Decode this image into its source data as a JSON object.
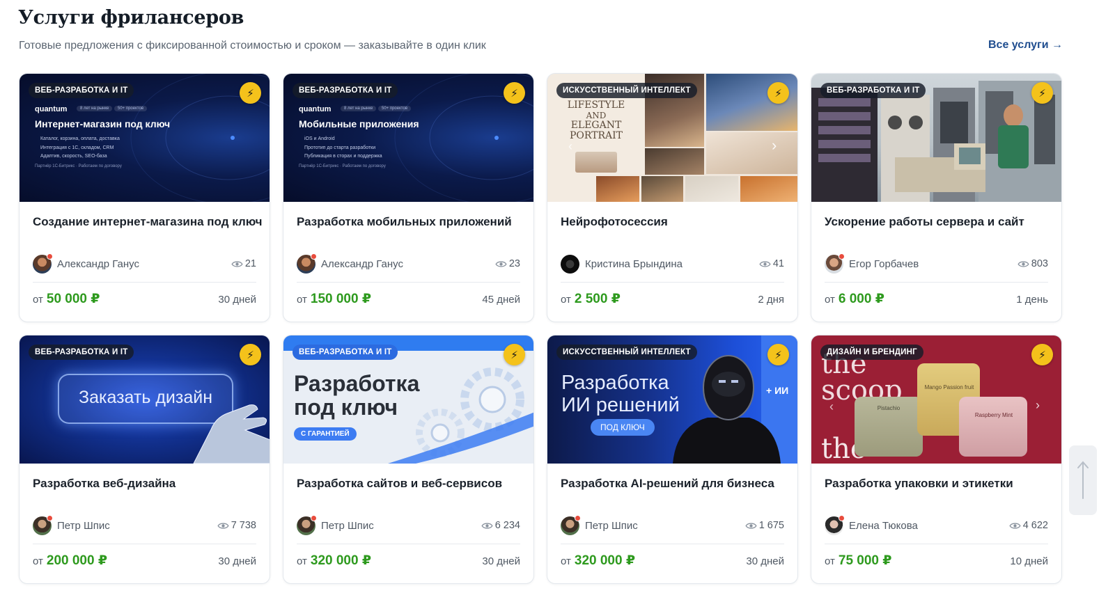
{
  "header": {
    "title": "Услуги фрилансеров",
    "subtitle": "Готовые предложения с фиксированной стоимостью и сроком — заказывайте в один клик",
    "all_link": "Все услуги →"
  },
  "colors": {
    "price_green": "#2e9a1e",
    "link_blue": "#1f4d8f",
    "bolt_yellow": "#f4c21b"
  },
  "cards": [
    {
      "category": "ВЕБ-РАЗРАБОТКА И IT",
      "image": {
        "brand": "quantum",
        "tag1": "8 лет на рынке",
        "tag2": "50+ проектов",
        "headline": "Интернет-магазин под ключ",
        "bullets": [
          "Каталог, корзина, оплата, доставка",
          "Интеграция с 1С, складом, CRM",
          "Адаптив, скорость, SEO-база"
        ],
        "footer": "Партнёр 1С-Битрикс · Работаем по договору"
      },
      "title": "Создание интернет-магазина под ключ",
      "author": "Александр Ганус",
      "views": "21",
      "price_prefix": "от",
      "price": "50 000 ₽",
      "duration": "30 дней"
    },
    {
      "category": "ВЕБ-РАЗРАБОТКА И IT",
      "image": {
        "brand": "quantum",
        "tag1": "8 лет на рынке",
        "tag2": "50+ проектов",
        "headline": "Мобильные приложения",
        "bullets": [
          "iOS и Android",
          "Прототип до старта разработки",
          "Публикация в сторах и поддержка"
        ],
        "footer": "Партнёр 1С-Битрикс · Работаем по договору"
      },
      "title": "Разработка мобильных приложений",
      "author": "Александр Ганус",
      "views": "23",
      "price_prefix": "от",
      "price": "150 000 ₽",
      "duration": "45 дней"
    },
    {
      "category": "ИСКУССТВЕННЫЙ ИНТЕЛЛЕКТ",
      "image": {
        "line1": "LIFESTYLE",
        "line2": "AND",
        "line3": "ELEGANT",
        "line4": "PORTRAIT"
      },
      "title": "Нейрофотосессия",
      "author": "Кристина Брындина",
      "views": "41",
      "price_prefix": "от",
      "price": "2 500 ₽",
      "duration": "2 дня"
    },
    {
      "category": "ВЕБ-РАЗРАБОТКА И IT",
      "image": {},
      "title": "Ускорение работы сервера и сайт",
      "author": "Егор Горбачев",
      "views": "803",
      "price_prefix": "от",
      "price": "6 000 ₽",
      "duration": "1 день"
    },
    {
      "category": "ВЕБ-РАЗРАБОТКА И IT",
      "image": {
        "button_text": "Заказать дизайн"
      },
      "title": "Разработка веб-дизайна",
      "author": "Петр Шпис",
      "views": "7 738",
      "price_prefix": "от",
      "price": "200 000 ₽",
      "duration": "30 дней"
    },
    {
      "category": "ВЕБ-РАЗРАБОТКА И IT",
      "image": {
        "line1": "Разработка",
        "line2": "под ключ",
        "pill": "С ГАРАНТИЕЙ"
      },
      "title": "Разработка сайтов и веб-сервисов",
      "author": "Петр Шпис",
      "views": "6 234",
      "price_prefix": "от",
      "price": "320 000 ₽",
      "duration": "30 дней"
    },
    {
      "category": "ИСКУССТВЕННЫЙ ИНТЕЛЛЕКТ",
      "image": {
        "line1": "Разработка",
        "line2": "ИИ решений",
        "pill": "ПОД КЛЮЧ",
        "side": "+ ИИ"
      },
      "title": "Разработка AI-решений для бизнеса",
      "author": "Петр Шпис",
      "views": "1 675",
      "price_prefix": "от",
      "price": "320 000 ₽",
      "duration": "30 дней"
    },
    {
      "category": "ДИЗАЙН И БРЕНДИНГ",
      "image": {
        "word1": "the",
        "word2": "scoop",
        "jar1": "Mango Passion fruit",
        "jar2": "Pistachio",
        "jar3": "Raspberry Mint"
      },
      "title": "Разработка упаковки и этикетки",
      "author": "Елена Тюкова",
      "views": "4 622",
      "price_prefix": "от",
      "price": "75 000 ₽",
      "duration": "10 дней"
    }
  ]
}
